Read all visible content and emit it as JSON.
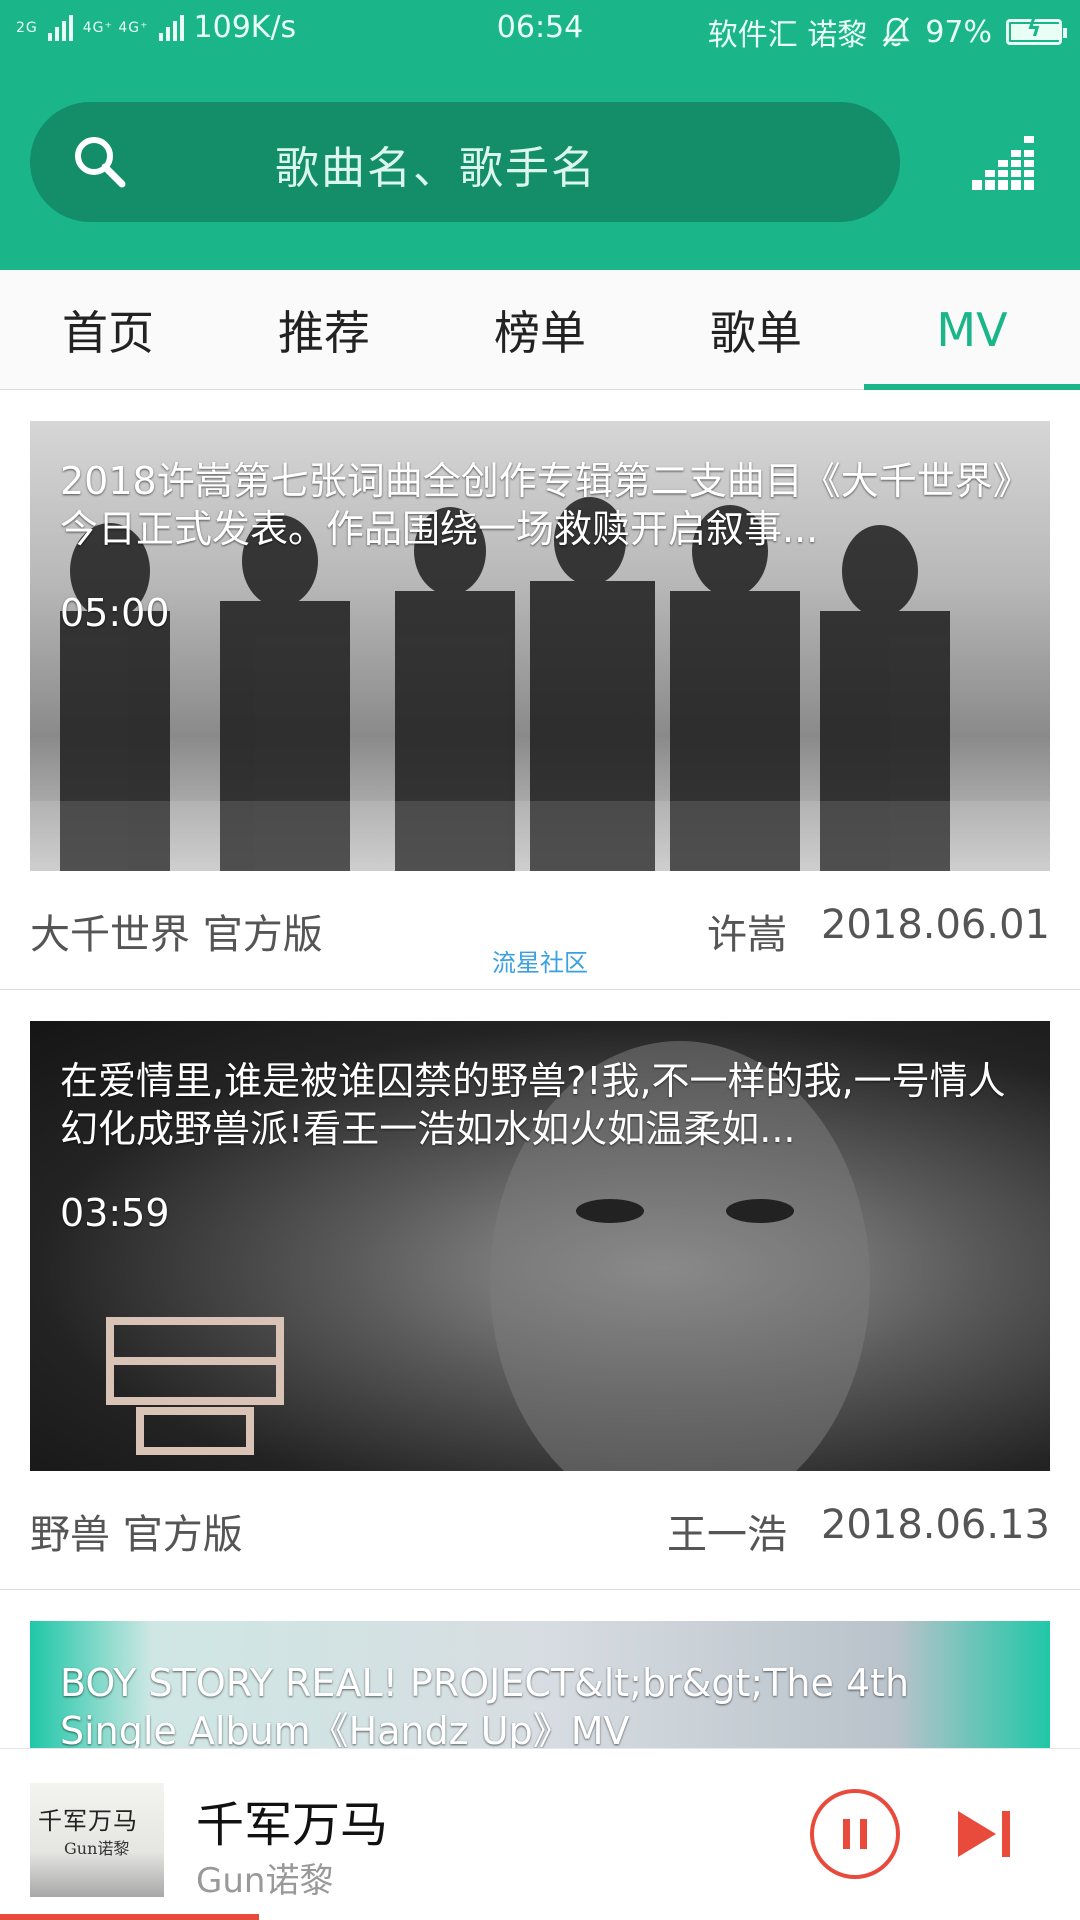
{
  "status_bar": {
    "network_left": "2G",
    "network_mid": "4G⁺ 4G⁺",
    "speed": "109K/s",
    "time": "06:54",
    "carrier": "软件汇 诺黎",
    "battery": "97%",
    "battery_level": 0.97
  },
  "search": {
    "placeholder": "歌曲名、歌手名",
    "icon": "search-icon",
    "right_icon": "equalizer-icon"
  },
  "tabs": [
    {
      "label": "首页",
      "active": false
    },
    {
      "label": "推荐",
      "active": false
    },
    {
      "label": "榜单",
      "active": false
    },
    {
      "label": "歌单",
      "active": false
    },
    {
      "label": "MV",
      "active": true
    }
  ],
  "mv_list": [
    {
      "description": "2018许嵩第七张词曲全创作专辑第二支曲目《大千世界》今日正式发表。作品围绕一场救赎开启叙事...",
      "duration": "05:00",
      "title": "大千世界 官方版",
      "artist": "许嵩",
      "date": "2018.06.01"
    },
    {
      "description": "在爱情里,谁是被谁囚禁的野兽?!我,不一样的我,一号情人幻化成野兽派!看王一浩如水如火如温柔如...",
      "duration": "03:59",
      "title": "野兽 官方版",
      "artist": "王一浩",
      "date": "2018.06.13"
    },
    {
      "description": "BOY STORY REAL! PROJECT&lt;br&gt;The 4th Single Album《Handz Up》MV"
    }
  ],
  "watermark": "流星社区",
  "player": {
    "title": "千军万马",
    "artist": "Gun诺黎",
    "cover_text": "千军万马",
    "cover_sub": "Gun诺黎",
    "progress": 0.24,
    "play_state": "pause-icon",
    "next": "skip-next-icon"
  },
  "colors": {
    "accent": "#1ab588",
    "search_bg": "#138e69",
    "player_red": "#e84a3c"
  }
}
